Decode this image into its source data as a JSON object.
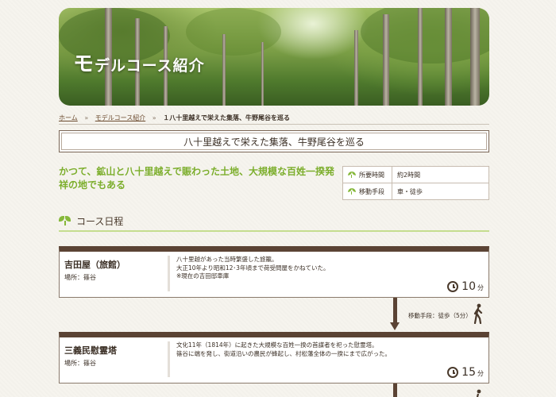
{
  "hero": {
    "title_first": "モ",
    "title_rest": "デルコース紹介"
  },
  "breadcrumb": {
    "items": [
      "ホーム",
      "モデルコース紹介"
    ],
    "current": "１八十里越えで栄えた集落、牛野尾谷を巡る",
    "separator": "»"
  },
  "page_title": "八十里越えで栄えた集落、牛野尾谷を巡る",
  "lead": "かつて、鉱山と八十里越えで賑わった土地、大規模な百姓一揆発祥の地でもある",
  "info": [
    {
      "label": "所要時間",
      "value": "約2時間"
    },
    {
      "label": "移動手段",
      "value": "車・徒歩"
    }
  ],
  "section_heading": "コース日程",
  "spots": [
    {
      "name": "吉田屋（旅館）",
      "place": "場所：篠谷",
      "desc": [
        "八十里越があった当時繁盛した旅籠。",
        "大正10年より昭和12･3年頃まで荷受問屋をかねていた。",
        "※現在の吉田邸車庫"
      ],
      "time_value": "10",
      "time_unit": "分"
    },
    {
      "name": "三義民慰霊塔",
      "place": "場所：篠谷",
      "desc": [
        "文化11年（1814年）に起きた大規模な百姓一揆の首謀者を祀った慰霊塔。",
        "篠谷に端を発し、街道沿いの農民が蜂起し、村松藩全体の一揆にまで広がった。"
      ],
      "time_value": "15",
      "time_unit": "分"
    }
  ],
  "move": "移動手段：徒歩（5分）"
}
